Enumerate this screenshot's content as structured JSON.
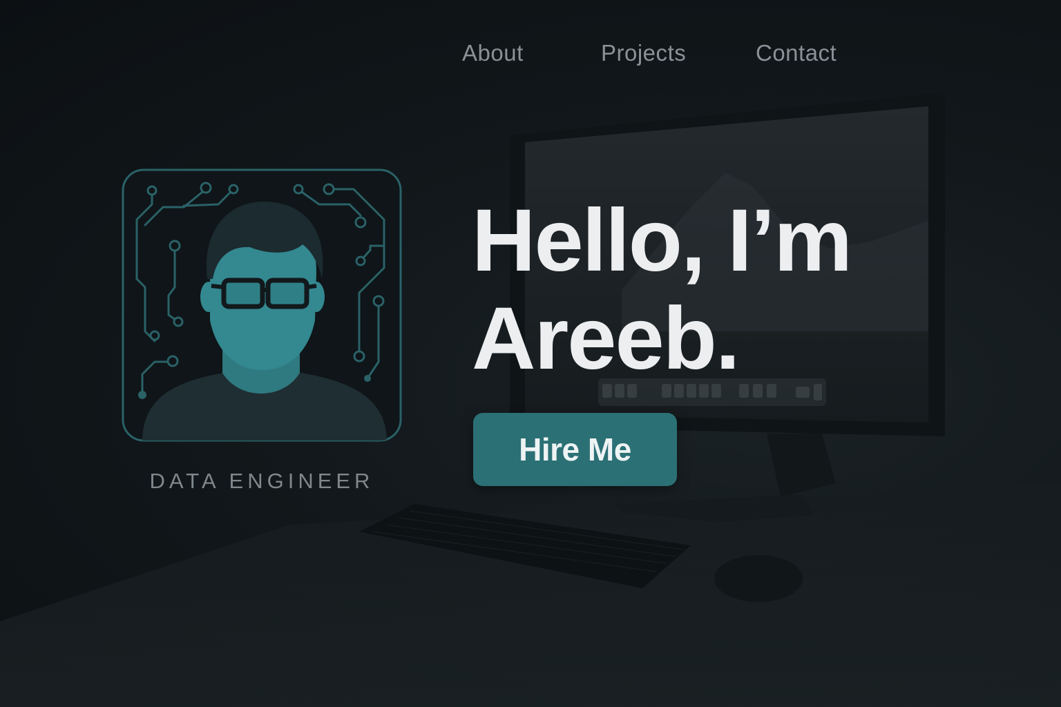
{
  "nav": {
    "items": [
      {
        "label": "About"
      },
      {
        "label": "Projects"
      },
      {
        "label": "Contact"
      }
    ]
  },
  "profile": {
    "avatar_icon": "developer-avatar-icon",
    "role": "DATA ENGINEER"
  },
  "hero": {
    "line1": "Hello, I’m",
    "line2": "Areeb.",
    "cta_label": "Hire Me"
  },
  "colors": {
    "accent": "#2b7075",
    "avatar_outline": "#2a6268",
    "background": "#0d1215",
    "heading": "#eceef0",
    "nav_text": "#8a9297"
  }
}
